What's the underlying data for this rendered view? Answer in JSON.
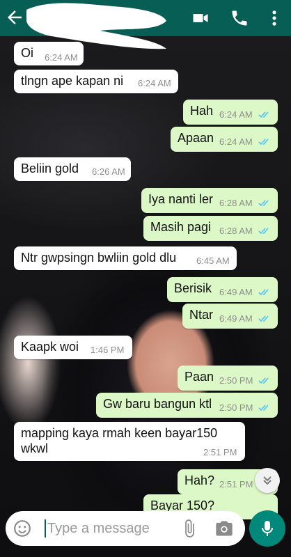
{
  "messages": [
    {
      "dir": "in",
      "text": "Oi",
      "time": "6:24 AM",
      "ticks": false
    },
    {
      "dir": "in",
      "text": "tlngn ape kapan ni",
      "time": "6:24 AM",
      "ticks": false
    },
    {
      "dir": "out",
      "text": "Hah",
      "time": "6:24 AM",
      "ticks": true
    },
    {
      "dir": "out",
      "text": "Apaan",
      "time": "6:24 AM",
      "ticks": true
    },
    {
      "dir": "in",
      "text": "Beliin gold",
      "time": "6:26 AM",
      "ticks": false
    },
    {
      "dir": "out",
      "text": "Iya nanti ler",
      "time": "6:28 AM",
      "ticks": true
    },
    {
      "dir": "out",
      "text": "Masih pagi",
      "time": "6:28 AM",
      "ticks": true
    },
    {
      "dir": "in",
      "text": "Ntr gwpsingn bwliin gold dlu",
      "time": "6:45 AM",
      "ticks": false
    },
    {
      "dir": "out",
      "text": "Berisik",
      "time": "6:49 AM",
      "ticks": true
    },
    {
      "dir": "out",
      "text": "Ntar",
      "time": "6:49 AM",
      "ticks": true
    },
    {
      "dir": "in",
      "text": "Kaapk woi",
      "time": "1:46 PM",
      "ticks": false
    },
    {
      "dir": "out",
      "text": "Paan",
      "time": "2:50 PM",
      "ticks": true
    },
    {
      "dir": "out",
      "text": "Gw baru bangun ktl",
      "time": "2:50 PM",
      "ticks": true
    },
    {
      "dir": "in",
      "text": "mapping kaya rmah keen bayar150",
      "text2": "wkwl",
      "time": "2:51 PM",
      "ticks": false
    },
    {
      "dir": "out",
      "text": "Hah?",
      "time": "2:51 PM",
      "ticks": true
    },
    {
      "dir": "out",
      "text": "Bayar 150?",
      "time": "",
      "ticks": true
    }
  ],
  "composer": {
    "placeholder": "Type a message"
  },
  "icons": {
    "back": "back-arrow-icon",
    "video": "video-call-icon",
    "call": "phone-icon",
    "menu": "more-vert-icon",
    "emoji": "emoji-icon",
    "attach": "paperclip-icon",
    "camera": "camera-icon",
    "mic": "mic-icon",
    "scroll": "scroll-down-icon"
  },
  "colors": {
    "header": "#075e54",
    "outgoing": "#dcf8c6",
    "incoming": "#ffffff",
    "read_ticks": "#4fc3f7",
    "mic": "#00897b"
  }
}
